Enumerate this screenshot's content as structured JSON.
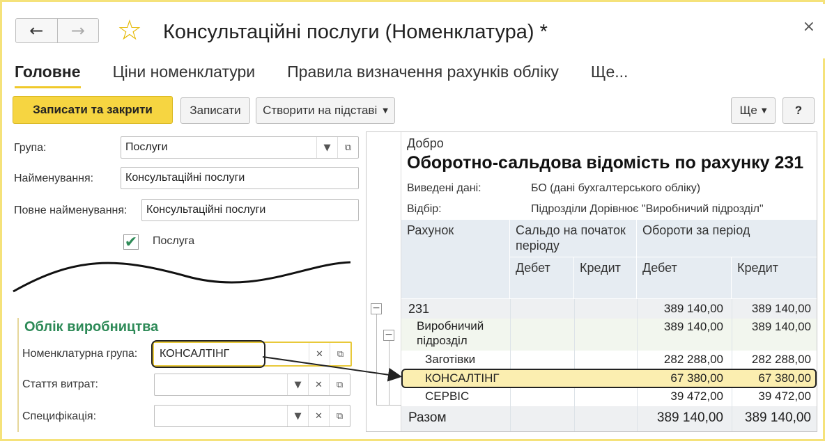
{
  "window": {
    "title": "Консультаційні послуги (Номенклатура) *",
    "back_icon": "←",
    "forward_icon": "→",
    "star_icon": "☆",
    "close_icon": "×"
  },
  "tabs": [
    "Головне",
    "Ціни номенклатури",
    "Правила визначення рахунків обліку",
    "Ще..."
  ],
  "toolbar": {
    "save_close": "Записати та закрити",
    "save": "Записати",
    "create_based": "Створити на підставі",
    "more": "Ще",
    "help": "?"
  },
  "form": {
    "group_label": "Група:",
    "group_value": "Послуги",
    "name_label": "Найменування:",
    "name_value": "Консультаційні послуги",
    "full_name_label": "Повне найменування:",
    "full_name_value": "Консультаційні послуги",
    "service_label": "Послуга",
    "service_checked": "✔"
  },
  "production": {
    "title": "Облік виробництва",
    "nomgroup_label": "Номенклатурна група:",
    "nomgroup_value": "КОНСАЛТІНГ",
    "cost_label": "Стаття витрат:",
    "cost_value": "",
    "spec_label": "Специфікація:",
    "spec_value": ""
  },
  "report": {
    "org": "Добро",
    "title": "Оборотно-сальдова відомість по рахунку 231",
    "entered_label": "Виведені дані:",
    "entered_value": "БО (дані бухгалтерського обліку)",
    "filter_label": "Відбір:",
    "filter_value": "Підрозділи Дорівнює \"Виробничий підрозділ\"",
    "headers": {
      "account": "Рахунок",
      "opening": "Сальдо на початок періоду",
      "turnover": "Обороти за період",
      "debit": "Дебет",
      "credit": "Кредит",
      "debit2": "Дебет",
      "credit2": "Кредит"
    },
    "rows": [
      {
        "name": "231",
        "debit": "389 140,00",
        "credit": "389 140,00"
      },
      {
        "name": "Виробничий підрозділ",
        "debit": "389 140,00",
        "credit": "389 140,00"
      },
      {
        "name": "Заготівки",
        "debit": "282 288,00",
        "credit": "282 288,00"
      },
      {
        "name": "КОНСАЛТІНГ",
        "debit": "67 380,00",
        "credit": "67 380,00"
      },
      {
        "name": "СЕРВІС",
        "debit": "39 472,00",
        "credit": "39 472,00"
      }
    ],
    "total": {
      "name": "Разом",
      "debit": "389 140,00",
      "credit": "389 140,00"
    },
    "collapse_icon": "−"
  }
}
